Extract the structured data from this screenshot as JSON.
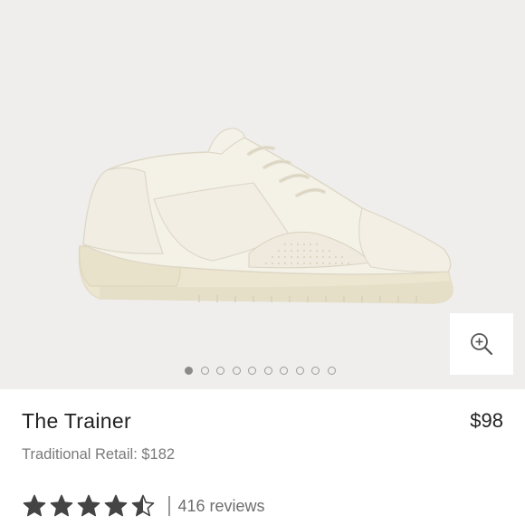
{
  "product": {
    "title": "The Trainer",
    "price": "$98",
    "traditional_retail": "Traditional Retail: $182",
    "rating": 4.5,
    "rating_max": 5,
    "reviews_label": "416 reviews"
  },
  "gallery": {
    "image_count": 10,
    "active_index": 0,
    "zoom_icon": "zoom-in-icon"
  },
  "colors": {
    "gallery_background": "#efeeec",
    "shoe": "#f1ede2",
    "star": "#444444",
    "text": "#222222",
    "muted": "#7a7a7a"
  }
}
